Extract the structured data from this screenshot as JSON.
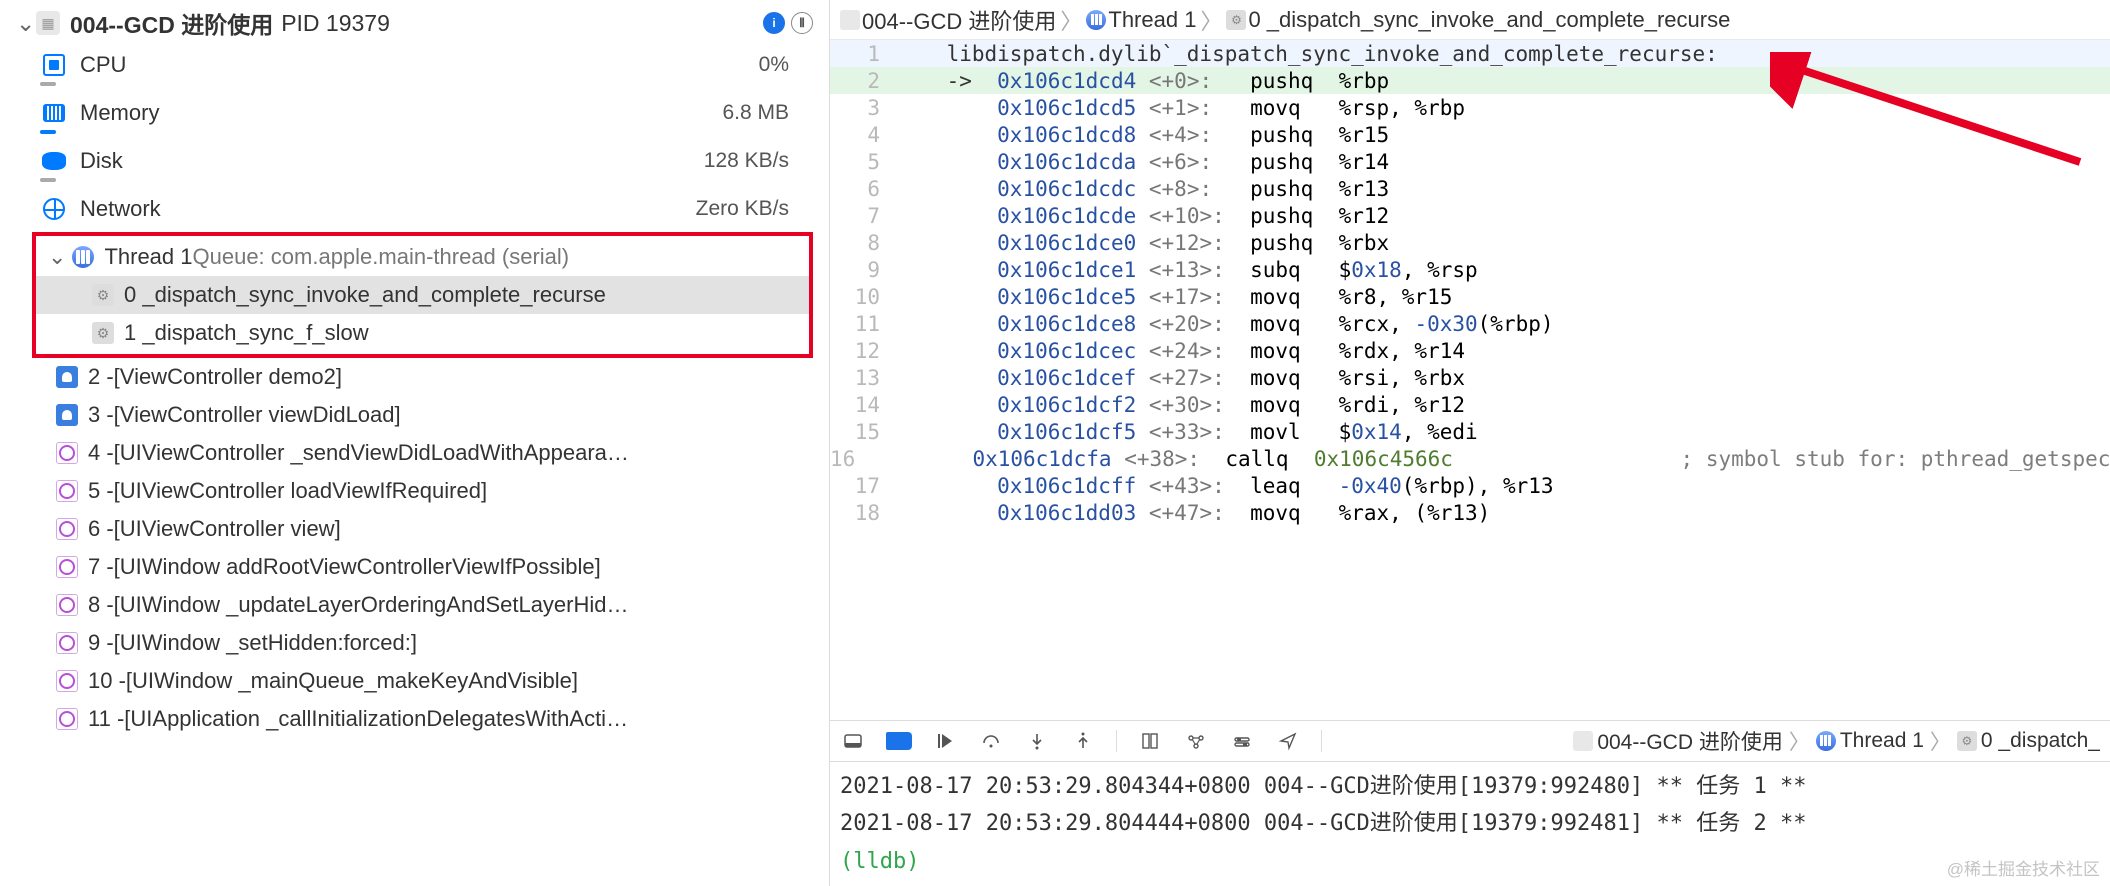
{
  "header": {
    "app_name": "004--GCD 进阶使用",
    "pid_label": "PID 19379",
    "info_icon": "i",
    "menu_icon": "⦀"
  },
  "stats": {
    "cpu_label": "CPU",
    "cpu_value": "0%",
    "mem_label": "Memory",
    "mem_value": "6.8 MB",
    "disk_label": "Disk",
    "disk_value": "128 KB/s",
    "net_label": "Network",
    "net_value": "Zero KB/s"
  },
  "thread": {
    "name": "Thread 1",
    "queue": " Queue: com.apple.main-thread (serial)"
  },
  "frames": [
    {
      "idx": "0",
      "label": "_dispatch_sync_invoke_and_complete_recurse",
      "kind": "gear",
      "selected": true
    },
    {
      "idx": "1",
      "label": "_dispatch_sync_f_slow",
      "kind": "gear",
      "selected": false
    },
    {
      "idx": "2",
      "label": "-[ViewController demo2]",
      "kind": "user",
      "selected": false
    },
    {
      "idx": "3",
      "label": "-[ViewController viewDidLoad]",
      "kind": "user",
      "selected": false
    },
    {
      "idx": "4",
      "label": "-[UIViewController _sendViewDidLoadWithAppeara…",
      "kind": "kit",
      "selected": false
    },
    {
      "idx": "5",
      "label": "-[UIViewController loadViewIfRequired]",
      "kind": "kit",
      "selected": false
    },
    {
      "idx": "6",
      "label": "-[UIViewController view]",
      "kind": "kit",
      "selected": false
    },
    {
      "idx": "7",
      "label": "-[UIWindow addRootViewControllerViewIfPossible]",
      "kind": "kit",
      "selected": false
    },
    {
      "idx": "8",
      "label": "-[UIWindow _updateLayerOrderingAndSetLayerHid…",
      "kind": "kit",
      "selected": false
    },
    {
      "idx": "9",
      "label": "-[UIWindow _setHidden:forced:]",
      "kind": "kit",
      "selected": false
    },
    {
      "idx": "10",
      "label": "-[UIWindow _mainQueue_makeKeyAndVisible]",
      "kind": "kit",
      "selected": false
    },
    {
      "idx": "11",
      "label": "-[UIApplication _callInitializationDelegatesWithActi…",
      "kind": "kit",
      "selected": false
    }
  ],
  "breadcrumb": {
    "item1": "004--GCD 进阶使用",
    "item2": "Thread 1",
    "item3": "0 _dispatch_sync_invoke_and_complete_recurse"
  },
  "code": {
    "symbol_line": "libdispatch.dylib`_dispatch_sync_invoke_and_complete_recurse:",
    "lines": [
      {
        "n": 1,
        "raw": "    libdispatch.dylib`_dispatch_sync_invoke_and_complete_recurse:",
        "plain": true,
        "hl": true
      },
      {
        "n": 2,
        "arrow": "->",
        "addr": "0x106c1dcd4",
        "off": "<+0>:",
        "op": "pushq",
        "args": "%rbp",
        "green": true
      },
      {
        "n": 3,
        "addr": "0x106c1dcd5",
        "off": "<+1>:",
        "op": "movq",
        "args": "%rsp, %rbp"
      },
      {
        "n": 4,
        "addr": "0x106c1dcd8",
        "off": "<+4>:",
        "op": "pushq",
        "args": "%r15"
      },
      {
        "n": 5,
        "addr": "0x106c1dcda",
        "off": "<+6>:",
        "op": "pushq",
        "args": "%r14"
      },
      {
        "n": 6,
        "addr": "0x106c1dcdc",
        "off": "<+8>:",
        "op": "pushq",
        "args": "%r13"
      },
      {
        "n": 7,
        "addr": "0x106c1dcde",
        "off": "<+10>:",
        "op": "pushq",
        "args": "%r12"
      },
      {
        "n": 8,
        "addr": "0x106c1dce0",
        "off": "<+12>:",
        "op": "pushq",
        "args": "%rbx"
      },
      {
        "n": 9,
        "addr": "0x106c1dce1",
        "off": "<+13>:",
        "op": "subq",
        "args": "$0x18, %rsp",
        "num": "0x18"
      },
      {
        "n": 10,
        "addr": "0x106c1dce5",
        "off": "<+17>:",
        "op": "movq",
        "args": "%r8, %r15"
      },
      {
        "n": 11,
        "addr": "0x106c1dce8",
        "off": "<+20>:",
        "op": "movq",
        "args": "%rcx, -0x30(%rbp)",
        "num": "0x30"
      },
      {
        "n": 12,
        "addr": "0x106c1dcec",
        "off": "<+24>:",
        "op": "movq",
        "args": "%rdx, %r14"
      },
      {
        "n": 13,
        "addr": "0x106c1dcef",
        "off": "<+27>:",
        "op": "movq",
        "args": "%rsi, %rbx"
      },
      {
        "n": 14,
        "addr": "0x106c1dcf2",
        "off": "<+30>:",
        "op": "movq",
        "args": "%rdi, %r12"
      },
      {
        "n": 15,
        "addr": "0x106c1dcf5",
        "off": "<+33>:",
        "op": "movl",
        "args": "$0x14, %edi",
        "num": "0x14"
      },
      {
        "n": 16,
        "addr": "0x106c1dcfa",
        "off": "<+38>:",
        "op": "callq",
        "call": "0x106c4566c",
        "comment": "; symbol stub for: pthread_getspecif"
      },
      {
        "n": 17,
        "addr": "0x106c1dcff",
        "off": "<+43>:",
        "op": "leaq",
        "args": "-0x40(%rbp), %r13",
        "num": "0x40"
      },
      {
        "n": 18,
        "addr": "0x106c1dd03",
        "off": "<+47>:",
        "op": "movq",
        "args": "%rax, (%r13)"
      }
    ]
  },
  "debug_breadcrumb": {
    "item1": "004--GCD 进阶使用",
    "item2": "Thread 1",
    "item3": "0 _dispatch_"
  },
  "console": {
    "line1": "2021-08-17 20:53:29.804344+0800 004--GCD进阶使用[19379:992480] ** 任务 1 **",
    "line2": "2021-08-17 20:53:29.804444+0800 004--GCD进阶使用[19379:992481] ** 任务 2 **",
    "prompt": "(lldb) "
  },
  "watermark": "@稀土掘金技术社区"
}
